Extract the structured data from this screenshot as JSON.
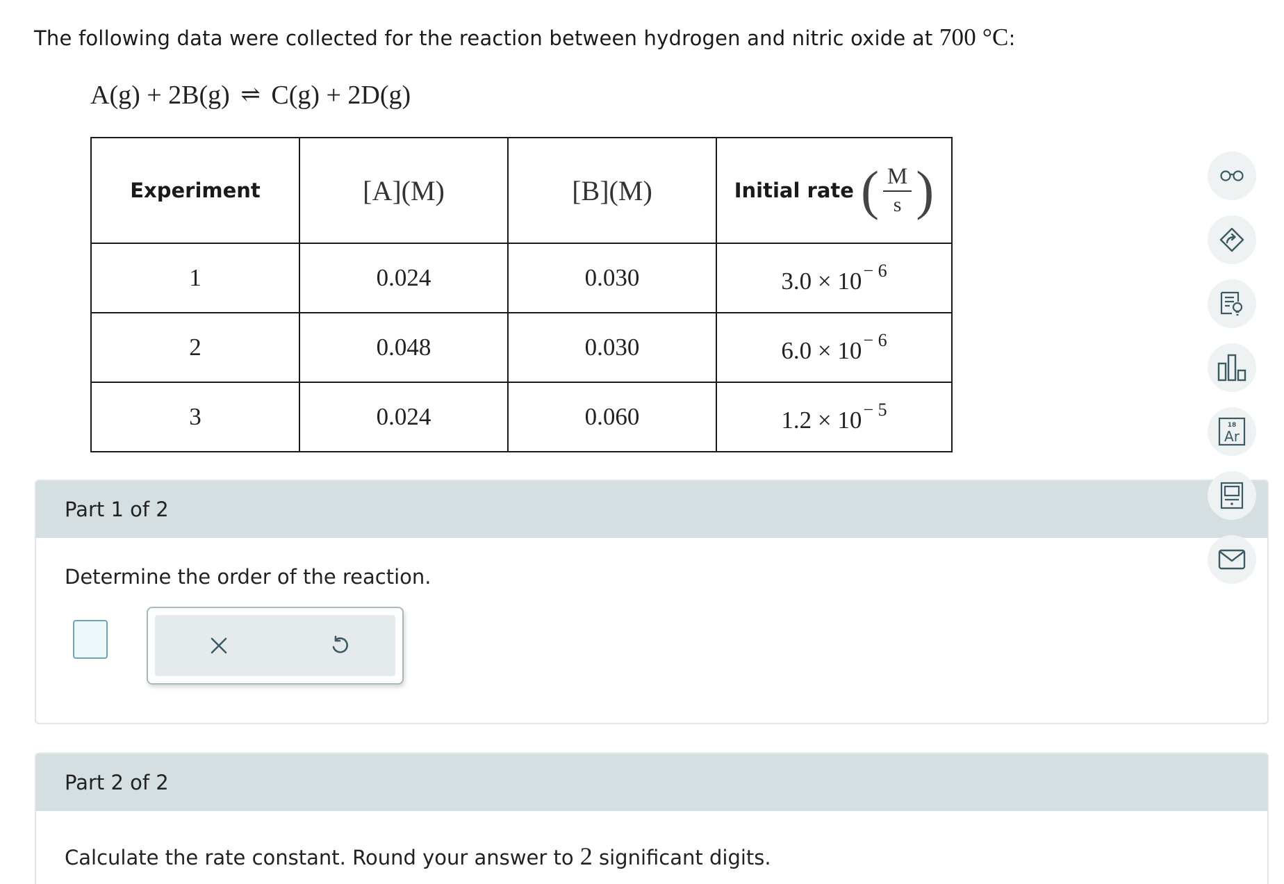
{
  "intro": {
    "text": "The following data were collected for the reaction between hydrogen and nitric oxide at ",
    "temperature": "700 °C",
    "colon": ":"
  },
  "equation": {
    "left": "A(g) + 2B(g)",
    "arrow": "⇌",
    "right": "C(g) + 2D(g)"
  },
  "table": {
    "headers": {
      "experiment": "Experiment",
      "a": "[A](M)",
      "b": "[B](M)",
      "rate": "Initial rate",
      "rate_unit_num": "M",
      "rate_unit_den": "s"
    },
    "rows": [
      {
        "exp": "1",
        "a": "0.024",
        "b": "0.030",
        "rate_mantissa": "3.0 × 10",
        "rate_exp": "− 6"
      },
      {
        "exp": "2",
        "a": "0.048",
        "b": "0.030",
        "rate_mantissa": "6.0 × 10",
        "rate_exp": "− 6"
      },
      {
        "exp": "3",
        "a": "0.024",
        "b": "0.060",
        "rate_mantissa": "1.2 × 10",
        "rate_exp": "− 5"
      }
    ]
  },
  "part1": {
    "header": "Part 1 of 2",
    "question": "Determine the order of the reaction."
  },
  "part2": {
    "header": "Part 2 of 2",
    "question_before": "Calculate the rate constant. Round your answer to ",
    "sig_digits": "2",
    "question_after": " significant digits."
  },
  "sidebar": {
    "icons": [
      "glasses-icon",
      "tag-arrow-icon",
      "notes-lightbulb-icon",
      "bar-chart-icon",
      "periodic-table-icon",
      "calculator-icon",
      "mail-icon"
    ],
    "periodic_number": "18",
    "periodic_symbol": "Ar"
  },
  "colors": {
    "panel_header": "#d5dee1",
    "accent": "#6aa6b8",
    "icon": "#3c5a64"
  }
}
